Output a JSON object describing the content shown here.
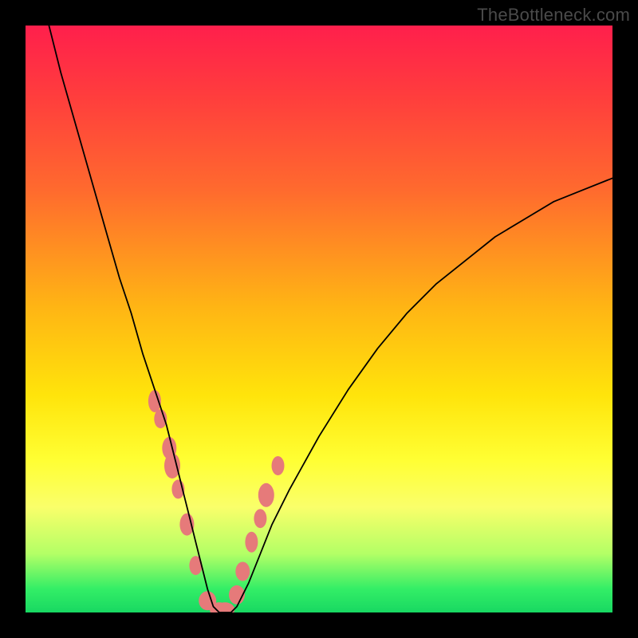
{
  "attribution": "TheBottleneck.com",
  "chart_data": {
    "type": "line",
    "title": "",
    "xlabel": "",
    "ylabel": "",
    "xlim": [
      0,
      100
    ],
    "ylim": [
      0,
      100
    ],
    "grid": false,
    "annotations": [],
    "series": [
      {
        "name": "bottleneck-curve",
        "x": [
          4,
          6,
          8,
          10,
          12,
          14,
          16,
          18,
          20,
          22,
          23,
          24,
          25,
          26,
          27,
          28,
          29,
          30,
          31,
          32,
          33,
          34,
          35,
          36,
          38,
          40,
          42,
          45,
          50,
          55,
          60,
          65,
          70,
          75,
          80,
          85,
          90,
          95,
          100
        ],
        "y": [
          100,
          92,
          85,
          78,
          71,
          64,
          57,
          51,
          44,
          38,
          35,
          32,
          28,
          24,
          20,
          16,
          12,
          8,
          4,
          1,
          0,
          0,
          0,
          1,
          5,
          10,
          15,
          21,
          30,
          38,
          45,
          51,
          56,
          60,
          64,
          67,
          70,
          72,
          74
        ]
      }
    ],
    "markers": {
      "name": "highlight-points",
      "x": [
        22,
        23,
        24.5,
        25,
        26,
        27.5,
        29,
        31,
        33,
        34,
        36,
        37,
        38.5,
        40,
        41,
        43
      ],
      "y": [
        36,
        33,
        28,
        25,
        21,
        15,
        8,
        2,
        0.5,
        0.5,
        3,
        7,
        12,
        16,
        20,
        25
      ],
      "rx": [
        8,
        8,
        9,
        10,
        8,
        9,
        8,
        11,
        12,
        12,
        10,
        9,
        8,
        8,
        10,
        8
      ],
      "ry": [
        14,
        12,
        14,
        16,
        12,
        14,
        12,
        12,
        9,
        9,
        12,
        12,
        13,
        12,
        15,
        12
      ]
    },
    "colors": {
      "curve": "#000000",
      "marker": "#e67a7a",
      "gradient_top": "#ff1f4c",
      "gradient_bottom": "#18d862"
    }
  }
}
